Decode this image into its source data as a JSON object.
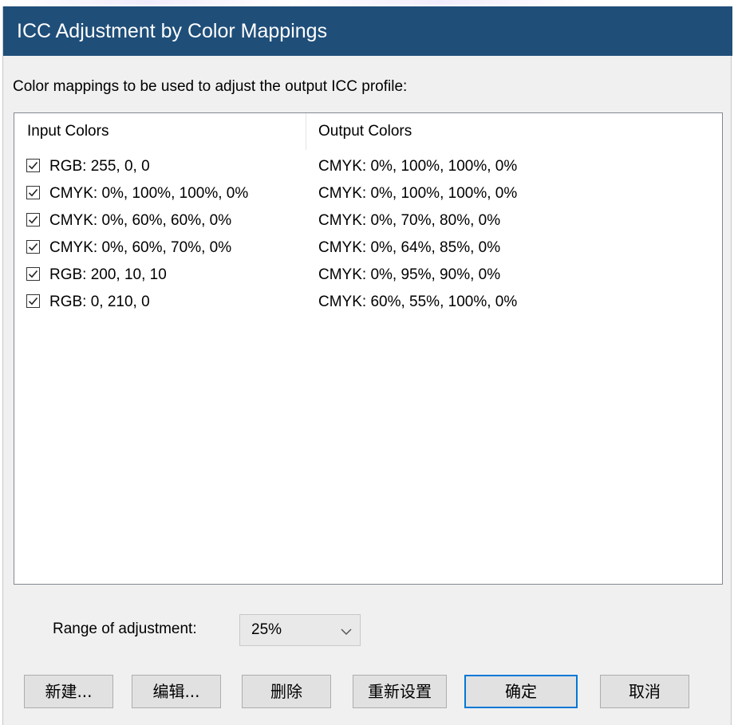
{
  "window": {
    "title": "ICC Adjustment by Color Mappings"
  },
  "prompt": "Color mappings to be used to adjust the output ICC profile:",
  "list": {
    "headers": [
      "Input Colors",
      "Output Colors"
    ],
    "rows": [
      {
        "checked": true,
        "input": "RGB: 255, 0, 0",
        "output": "CMYK: 0%, 100%, 100%, 0%"
      },
      {
        "checked": true,
        "input": "CMYK: 0%, 100%, 100%, 0%",
        "output": "CMYK: 0%, 100%, 100%, 0%"
      },
      {
        "checked": true,
        "input": "CMYK: 0%, 60%, 60%, 0%",
        "output": "CMYK: 0%, 70%, 80%, 0%"
      },
      {
        "checked": true,
        "input": "CMYK: 0%, 60%, 70%, 0%",
        "output": "CMYK: 0%, 64%, 85%, 0%"
      },
      {
        "checked": true,
        "input": "RGB: 200, 10, 10",
        "output": "CMYK: 0%, 95%, 90%, 0%"
      },
      {
        "checked": true,
        "input": "RGB: 0, 210, 0",
        "output": "CMYK: 60%, 55%, 100%, 0%"
      }
    ]
  },
  "range": {
    "label": "Range of adjustment:",
    "value": "25%",
    "icon": "chevron-down-icon"
  },
  "buttons": {
    "new": "新建...",
    "edit": "编辑...",
    "delete": "删除",
    "reset": "重新设置",
    "ok": "确定",
    "cancel": "取消"
  },
  "colors": {
    "titlebar": "#1f4e79",
    "dialog_bg": "#f0f0f0",
    "default_button_border": "#0078d7"
  }
}
